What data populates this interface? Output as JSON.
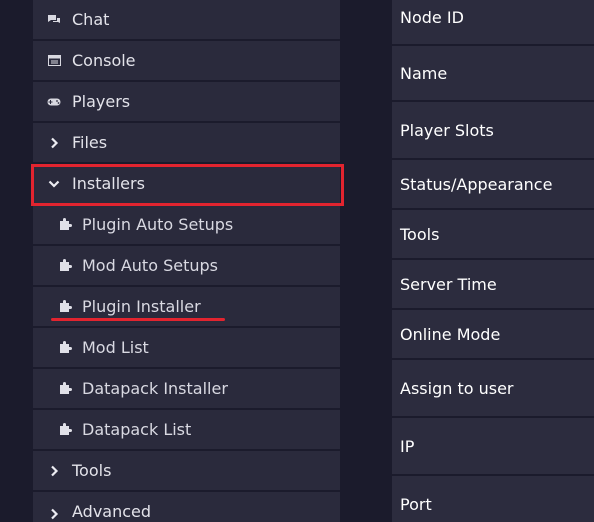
{
  "sidebar": {
    "items": [
      {
        "label": "Chat",
        "icon": "chat-icon"
      },
      {
        "label": "Console",
        "icon": "console-icon"
      },
      {
        "label": "Players",
        "icon": "gamepad-icon"
      },
      {
        "label": "Files",
        "icon": "chevron-right-icon"
      },
      {
        "label": "Installers",
        "icon": "chevron-down-icon"
      },
      {
        "label": "Plugin Auto Setups",
        "icon": "puzzle-icon"
      },
      {
        "label": "Mod Auto Setups",
        "icon": "puzzle-icon"
      },
      {
        "label": "Plugin Installer",
        "icon": "puzzle-icon"
      },
      {
        "label": "Mod List",
        "icon": "puzzle-icon"
      },
      {
        "label": "Datapack Installer",
        "icon": "puzzle-icon"
      },
      {
        "label": "Datapack List",
        "icon": "puzzle-icon"
      },
      {
        "label": "Tools",
        "icon": "chevron-right-icon"
      },
      {
        "label": "Advanced",
        "icon": "chevron-right-icon"
      }
    ]
  },
  "info_table": {
    "rows": [
      {
        "label": "Node ID"
      },
      {
        "label": "Name"
      },
      {
        "label": "Player Slots"
      },
      {
        "label": "Status/Appearance"
      },
      {
        "label": "Tools"
      },
      {
        "label": "Server Time"
      },
      {
        "label": "Online Mode"
      },
      {
        "label": "Assign to user"
      },
      {
        "label": "IP"
      },
      {
        "label": "Port"
      }
    ]
  },
  "colors": {
    "background": "#1b1b2c",
    "panel": "#2a2a3c",
    "highlight": "#e2242f",
    "text": "#e3e3ea"
  }
}
